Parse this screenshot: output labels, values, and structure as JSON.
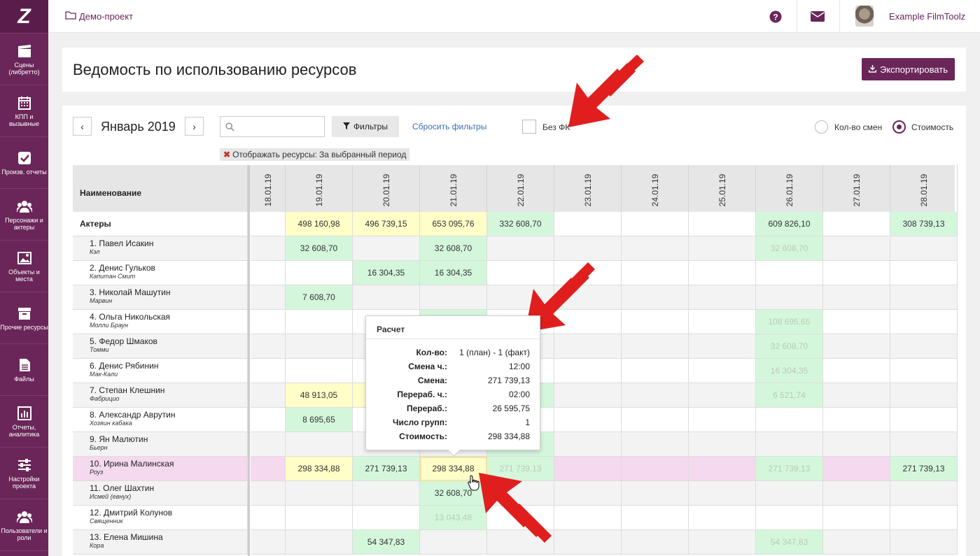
{
  "sidebar": {
    "logo": "Z",
    "items": [
      {
        "label": "Сцены (либретто)",
        "icon": "clapperboard-icon"
      },
      {
        "label": "КПП и вызывные",
        "icon": "calendar-icon"
      },
      {
        "label": "Произв. отчеты",
        "icon": "checkbox-icon"
      },
      {
        "label": "Персонажи и актеры",
        "icon": "users-icon"
      },
      {
        "label": "Объекты и места",
        "icon": "image-icon"
      },
      {
        "label": "Прочие ресурсы",
        "icon": "archive-icon"
      },
      {
        "label": "Файлы",
        "icon": "file-icon"
      },
      {
        "label": "Отчеты, аналитика",
        "icon": "bar-chart-icon"
      },
      {
        "label": "Настройки проекта",
        "icon": "sliders-icon"
      },
      {
        "label": "Пользователи и роли",
        "icon": "users-icon"
      }
    ]
  },
  "topbar": {
    "breadcrumb": "Демо-проект",
    "user_name": "Example FilmToolz"
  },
  "page": {
    "title": "Ведомость по использованию ресурсов",
    "export_label": "Экспортировать"
  },
  "toolbar": {
    "prev": "‹",
    "next": "›",
    "month": "Январь 2019",
    "search_placeholder": "",
    "filters_label": "Фильтры",
    "reset_label": "Сбросить фильтры",
    "no_fk_label": "Без ФК",
    "no_fk_checked": false,
    "radio_shifts_label": "Кол-во смен",
    "radio_cost_label": "Стоимость",
    "selected_mode": "Стоимость",
    "tag_label": "Отображать ресурсы:",
    "tag_value": "За выбранный период"
  },
  "table": {
    "name_header": "Наименование",
    "dates": [
      "18.01.19",
      "19.01.19",
      "20.01.19",
      "21.01.19",
      "22.01.19",
      "23.01.19",
      "24.01.19",
      "25.01.19",
      "26.01.19",
      "27.01.19",
      "28.01.19"
    ],
    "rows": [
      {
        "name": "Актеры",
        "role": "",
        "group": true,
        "cells": [
          [
            "",
            ""
          ],
          [
            "498 160,98",
            "y"
          ],
          [
            "496 739,15",
            "y"
          ],
          [
            "653 095,76",
            "y"
          ],
          [
            "332 608,70",
            "g"
          ],
          [
            "",
            ""
          ],
          [
            "",
            ""
          ],
          [
            "",
            ""
          ],
          [
            "609 826,10",
            "g"
          ],
          [
            "",
            ""
          ],
          [
            "308 739,13",
            "g"
          ]
        ]
      },
      {
        "name": "1. Павел Исакин",
        "role": "Кэл",
        "cells": [
          [
            "",
            ""
          ],
          [
            "32 608,70",
            "g"
          ],
          [
            "",
            ""
          ],
          [
            "32 608,70",
            "g"
          ],
          [
            "",
            ""
          ],
          [
            "",
            ""
          ],
          [
            "",
            ""
          ],
          [
            "",
            ""
          ],
          [
            "32 608,70",
            "gf"
          ],
          [
            "",
            ""
          ],
          [
            "",
            ""
          ]
        ]
      },
      {
        "name": "2. Денис Гульков",
        "role": "Капитан Смит",
        "cells": [
          [
            "",
            ""
          ],
          [
            "",
            ""
          ],
          [
            "16 304,35",
            "g"
          ],
          [
            "16 304,35",
            "g"
          ],
          [
            "",
            ""
          ],
          [
            "",
            ""
          ],
          [
            "",
            ""
          ],
          [
            "",
            ""
          ],
          [
            "",
            ""
          ],
          [
            "",
            ""
          ],
          [
            "",
            ""
          ]
        ]
      },
      {
        "name": "3. Николай Машутин",
        "role": "Марвин",
        "cells": [
          [
            "",
            ""
          ],
          [
            "7 608,70",
            "g"
          ],
          [
            "",
            ""
          ],
          [
            "",
            ""
          ],
          [
            "",
            ""
          ],
          [
            "",
            ""
          ],
          [
            "",
            ""
          ],
          [
            "",
            ""
          ],
          [
            "",
            ""
          ],
          [
            "",
            ""
          ],
          [
            "",
            ""
          ]
        ]
      },
      {
        "name": "4. Ольга Никольская",
        "role": "Молли Браун",
        "cells": [
          [
            "",
            ""
          ],
          [
            "",
            ""
          ],
          [
            "",
            ""
          ],
          [
            "",
            "g"
          ],
          [
            "",
            ""
          ],
          [
            "",
            ""
          ],
          [
            "",
            ""
          ],
          [
            "",
            ""
          ],
          [
            "108 695,65",
            "gf"
          ],
          [
            "",
            ""
          ],
          [
            "",
            ""
          ]
        ]
      },
      {
        "name": "5. Федор Шмаков",
        "role": "Томми",
        "cells": [
          [
            "",
            ""
          ],
          [
            "",
            ""
          ],
          [
            "",
            ""
          ],
          [
            "",
            ""
          ],
          [
            "",
            ""
          ],
          [
            "",
            ""
          ],
          [
            "",
            ""
          ],
          [
            "",
            ""
          ],
          [
            "32 608,70",
            "gf"
          ],
          [
            "",
            ""
          ],
          [
            "",
            ""
          ]
        ]
      },
      {
        "name": "6. Денис Рябинин",
        "role": "Мак-Кали",
        "cells": [
          [
            "",
            ""
          ],
          [
            "",
            ""
          ],
          [
            "",
            ""
          ],
          [
            "",
            ""
          ],
          [
            "",
            ""
          ],
          [
            "",
            ""
          ],
          [
            "",
            ""
          ],
          [
            "",
            ""
          ],
          [
            "16 304,35",
            "gf"
          ],
          [
            "",
            ""
          ],
          [
            "",
            ""
          ]
        ]
      },
      {
        "name": "7. Степан Клешнин",
        "role": "Фабрицио",
        "cells": [
          [
            "",
            ""
          ],
          [
            "48 913,05",
            "y"
          ],
          [
            "",
            "y"
          ],
          [
            "",
            ""
          ],
          [
            "",
            "g"
          ],
          [
            "",
            ""
          ],
          [
            "",
            ""
          ],
          [
            "",
            ""
          ],
          [
            "6 521,74",
            "gf"
          ],
          [
            "",
            ""
          ],
          [
            "",
            ""
          ]
        ]
      },
      {
        "name": "8. Александр Аврутин",
        "role": "Хозяин кабака",
        "cells": [
          [
            "",
            ""
          ],
          [
            "8 695,65",
            "g"
          ],
          [
            "",
            ""
          ],
          [
            "",
            ""
          ],
          [
            "",
            ""
          ],
          [
            "",
            ""
          ],
          [
            "",
            ""
          ],
          [
            "",
            ""
          ],
          [
            "",
            ""
          ],
          [
            "",
            ""
          ],
          [
            "",
            ""
          ]
        ]
      },
      {
        "name": "9. Ян Малютин",
        "role": "Бьерн",
        "cells": [
          [
            "",
            ""
          ],
          [
            "",
            ""
          ],
          [
            "",
            ""
          ],
          [
            "",
            ""
          ],
          [
            "",
            "g"
          ],
          [
            "",
            ""
          ],
          [
            "",
            ""
          ],
          [
            "",
            ""
          ],
          [
            "",
            ""
          ],
          [
            "",
            ""
          ],
          [
            "",
            ""
          ]
        ]
      },
      {
        "name": "10. Ирина Малинская",
        "role": "Роуз",
        "highlight": true,
        "cells": [
          [
            "",
            "pk"
          ],
          [
            "298 334,88",
            "y"
          ],
          [
            "271 739,13",
            "g"
          ],
          [
            "298 334,88",
            "ysel"
          ],
          [
            "271 739,13",
            "gf"
          ],
          [
            "",
            "pk"
          ],
          [
            "",
            "pk"
          ],
          [
            "",
            "pk"
          ],
          [
            "271 739,13",
            "gf"
          ],
          [
            "",
            "pk"
          ],
          [
            "271 739,13",
            "g"
          ]
        ]
      },
      {
        "name": "11. Олег Шахтин",
        "role": "Исмей (евнух)",
        "cells": [
          [
            "",
            ""
          ],
          [
            "",
            ""
          ],
          [
            "",
            ""
          ],
          [
            "32 608,70",
            "g"
          ],
          [
            "",
            ""
          ],
          [
            "",
            ""
          ],
          [
            "",
            ""
          ],
          [
            "",
            ""
          ],
          [
            "",
            ""
          ],
          [
            "",
            ""
          ],
          [
            "",
            ""
          ]
        ]
      },
      {
        "name": "12. Дмитрий Колунов",
        "role": "Священник",
        "cells": [
          [
            "",
            ""
          ],
          [
            "",
            ""
          ],
          [
            "",
            ""
          ],
          [
            "13 043,48",
            "gf"
          ],
          [
            "",
            ""
          ],
          [
            "",
            ""
          ],
          [
            "",
            ""
          ],
          [
            "",
            ""
          ],
          [
            "",
            ""
          ],
          [
            "",
            ""
          ],
          [
            "",
            ""
          ]
        ]
      },
      {
        "name": "13. Елена Мишина",
        "role": "Кора",
        "cells": [
          [
            "",
            ""
          ],
          [
            "",
            ""
          ],
          [
            "54 347,83",
            "g"
          ],
          [
            "",
            ""
          ],
          [
            "",
            ""
          ],
          [
            "",
            ""
          ],
          [
            "",
            ""
          ],
          [
            "",
            ""
          ],
          [
            "54 347,83",
            "gf"
          ],
          [
            "",
            ""
          ],
          [
            "",
            ""
          ]
        ]
      }
    ]
  },
  "tooltip": {
    "title": "Расчет",
    "rows": [
      {
        "k": "Кол-во:",
        "v": "1 (план) - 1 (факт)"
      },
      {
        "k": "Смена ч.:",
        "v": "12:00"
      },
      {
        "k": "Смена:",
        "v": "271 739,13"
      },
      {
        "k": "Перераб. ч.:",
        "v": "02:00"
      },
      {
        "k": "Перераб.:",
        "v": "26 595,75"
      },
      {
        "k": "Число групп:",
        "v": "1"
      },
      {
        "k": "Стоимость:",
        "v": "298 334,88"
      }
    ]
  },
  "colors": {
    "brand": "#6a2659",
    "yellow_cell": "#fffdc8",
    "green_cell": "#d4f7dc",
    "pink_row": "#f5d9ee",
    "arrow_red": "#e01e1e"
  }
}
